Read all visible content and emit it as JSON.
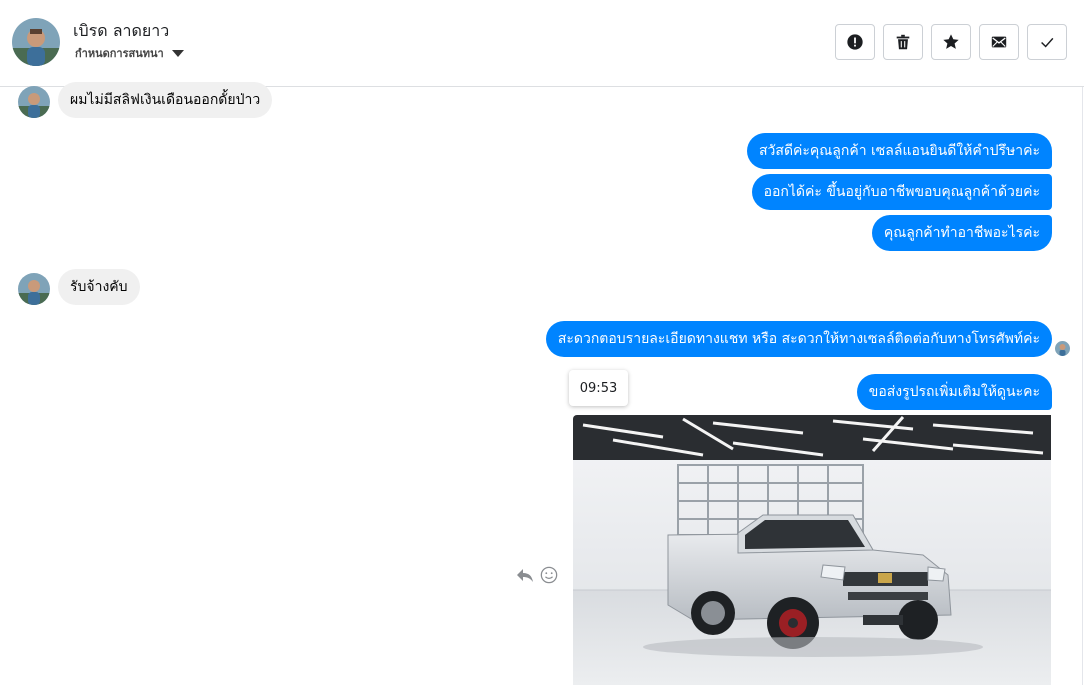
{
  "header": {
    "contact_name": "เบิรด ลาดยาว",
    "subtitle": "กำหนดการสนทนา",
    "avatar_icon": "user-avatar",
    "actions": [
      {
        "name": "report-icon",
        "label": "Report"
      },
      {
        "name": "trash-icon",
        "label": "Delete"
      },
      {
        "name": "star-icon",
        "label": "Star"
      },
      {
        "name": "mail-icon",
        "label": "Mark unread"
      },
      {
        "name": "check-icon",
        "label": "Done"
      }
    ]
  },
  "messages": [
    {
      "direction": "in",
      "text": "ผมไม่มีสลิฟเงินเดือนออกดั้ยป่าว"
    },
    {
      "direction": "out",
      "text": "สวัสดีค่ะคุณลูกค้า เซลล์แอนยินดีให้คำปรึษาค่ะ"
    },
    {
      "direction": "out",
      "text": "ออกได้ค่ะ ขึ้นอยู่กับอาชีพขอบคุณลูกค้าด้วยค่ะ"
    },
    {
      "direction": "out",
      "text": "คุณลูกค้าทำอาชีพอะไรค่ะ"
    },
    {
      "direction": "in",
      "text": "รับจ้างคับ"
    },
    {
      "direction": "out",
      "text": "สะดวกตอบรายละเอียดทางแชท หรือ สะดวกให้ทางเซลล์ติดต่อกับทางโทรศัพท์ค่ะ"
    },
    {
      "direction": "out",
      "text": "ขอส่งรูปรถเพิ่มเติมให้ดูนะคะ"
    }
  ],
  "tooltip_time": "09:53",
  "colors": {
    "outgoing_bubble": "#0084ff",
    "incoming_bubble": "#f0f0f0"
  },
  "photo": {
    "subject": "white pickup truck with steel cargo cage"
  }
}
